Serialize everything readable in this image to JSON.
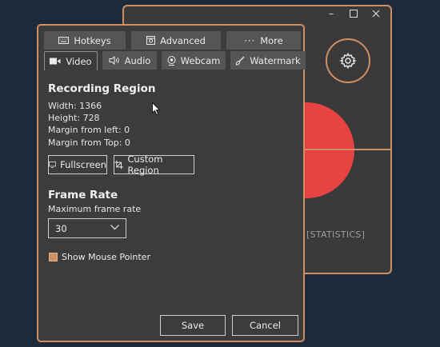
{
  "back_window": {
    "stats_label": "[STATISTICS]",
    "controls": [
      "minimize",
      "maximize",
      "close"
    ]
  },
  "tabs": {
    "row1": [
      {
        "label": "Hotkeys",
        "icon": "keyboard-icon"
      },
      {
        "label": "Advanced",
        "icon": "advanced-icon"
      },
      {
        "label": "More",
        "icon": "ellipsis-icon"
      }
    ],
    "row2": [
      {
        "label": "Video",
        "icon": "video-camera-icon",
        "active": true
      },
      {
        "label": "Audio",
        "icon": "speaker-icon"
      },
      {
        "label": "Webcam",
        "icon": "webcam-icon"
      },
      {
        "label": "Watermark",
        "icon": "brush-icon"
      }
    ]
  },
  "recording_region": {
    "title": "Recording Region",
    "width_line": "Width:  1366",
    "height_line": "Height:  728",
    "margin_left_line": "Margin from left:  0",
    "margin_top_line": "Margin from Top:  0",
    "fullscreen_label": "Fullscreen",
    "custom_region_label": "Custom Region"
  },
  "frame_rate": {
    "title": "Frame Rate",
    "label": "Maximum frame rate",
    "value": "30"
  },
  "show_mouse": {
    "label": "Show Mouse Pointer",
    "checked": true
  },
  "footer": {
    "save_label": "Save",
    "cancel_label": "Cancel"
  },
  "colors": {
    "accent": "#d08f63",
    "record": "#e84343",
    "panel": "#3c3c3c",
    "backdrop": "#1c2a3c"
  }
}
